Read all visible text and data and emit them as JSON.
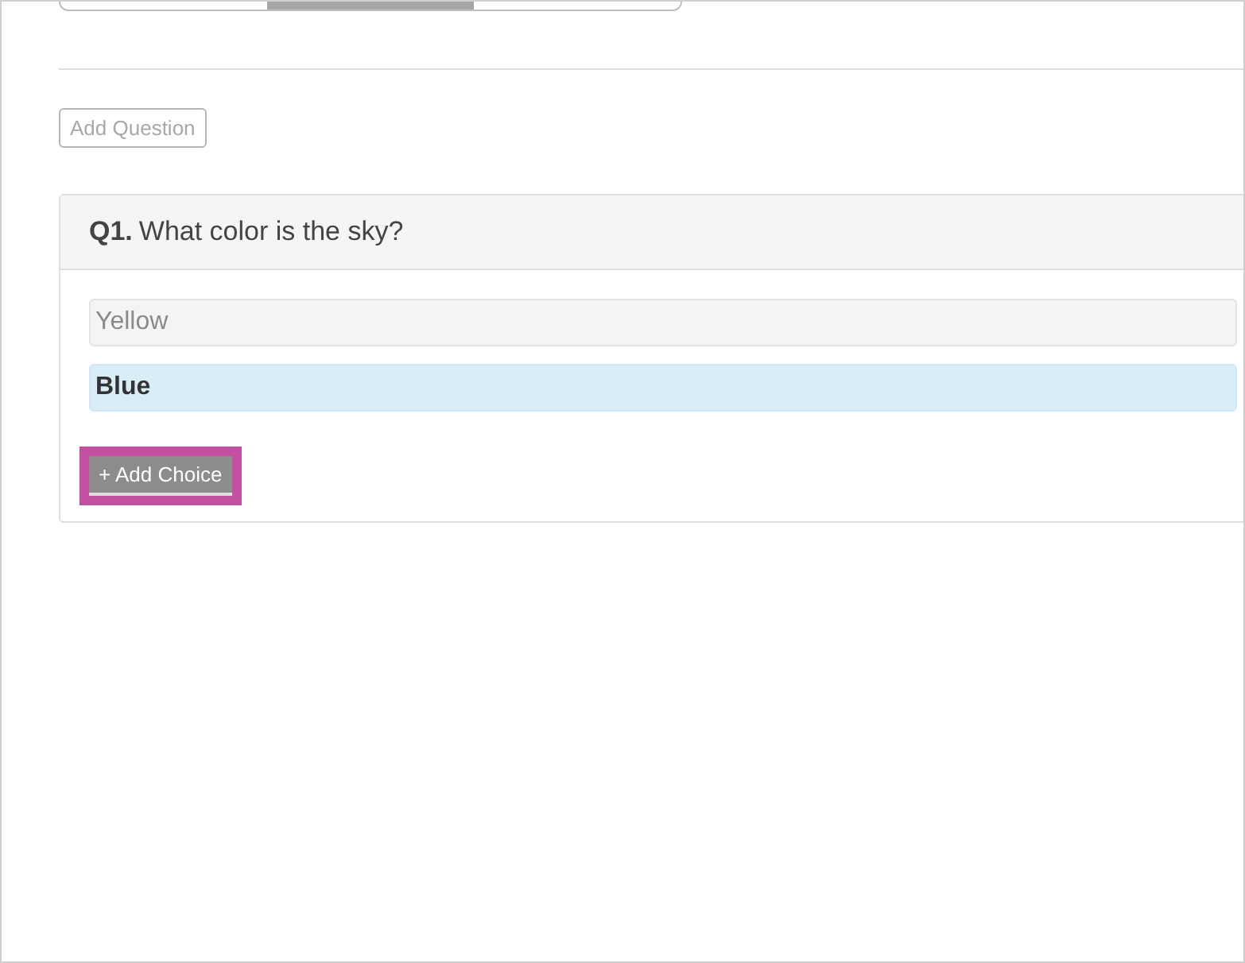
{
  "segments": [
    {
      "selected": false
    },
    {
      "selected": true
    },
    {
      "selected": false
    }
  ],
  "add_question_button": {
    "label": "Add Question"
  },
  "question": {
    "number": "Q1.",
    "text": "What color is the sky?",
    "choices": [
      {
        "label": "Yellow",
        "selected": false
      },
      {
        "label": "Blue",
        "selected": true
      }
    ],
    "add_choice_button": {
      "label": "+ Add Choice",
      "highlighted": true
    }
  }
}
